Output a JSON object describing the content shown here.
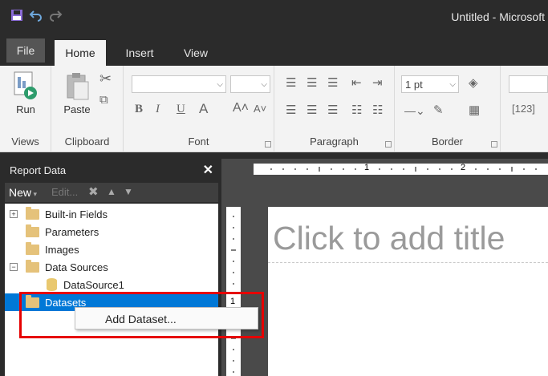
{
  "window": {
    "title": "Untitled - Microsoft"
  },
  "ribbon": {
    "tabs": [
      "File",
      "Home",
      "Insert",
      "View"
    ],
    "groups": {
      "views": {
        "label": "Views",
        "run_label": "Run"
      },
      "clipboard": {
        "label": "Clipboard",
        "paste_label": "Paste"
      },
      "font": {
        "label": "Font",
        "bold": "B",
        "italic": "I",
        "underline": "U",
        "font_color": "A",
        "grow": "A˄",
        "shrink": "A˅"
      },
      "paragraph": {
        "label": "Paragraph"
      },
      "border": {
        "label": "Border",
        "weight_value": "1 pt"
      }
    }
  },
  "report_data": {
    "title": "Report Data",
    "close": "✕",
    "toolbar": {
      "new_label": "New",
      "edit_label": "Edit..."
    },
    "tree": {
      "builtin": "Built-in Fields",
      "parameters": "Parameters",
      "images": "Images",
      "data_sources": "Data Sources",
      "data_source_1": "DataSource1",
      "datasets": "Datasets"
    }
  },
  "context_menu": {
    "add_dataset": "Add Dataset..."
  },
  "canvas": {
    "title_placeholder": "Click to add title",
    "ruler": {
      "mark1": "1",
      "mark2": "2",
      "vmark": "1"
    }
  },
  "colors": {
    "selection": "#0078d7",
    "highlight": "#e60000",
    "chrome": "#2b2b2b"
  }
}
